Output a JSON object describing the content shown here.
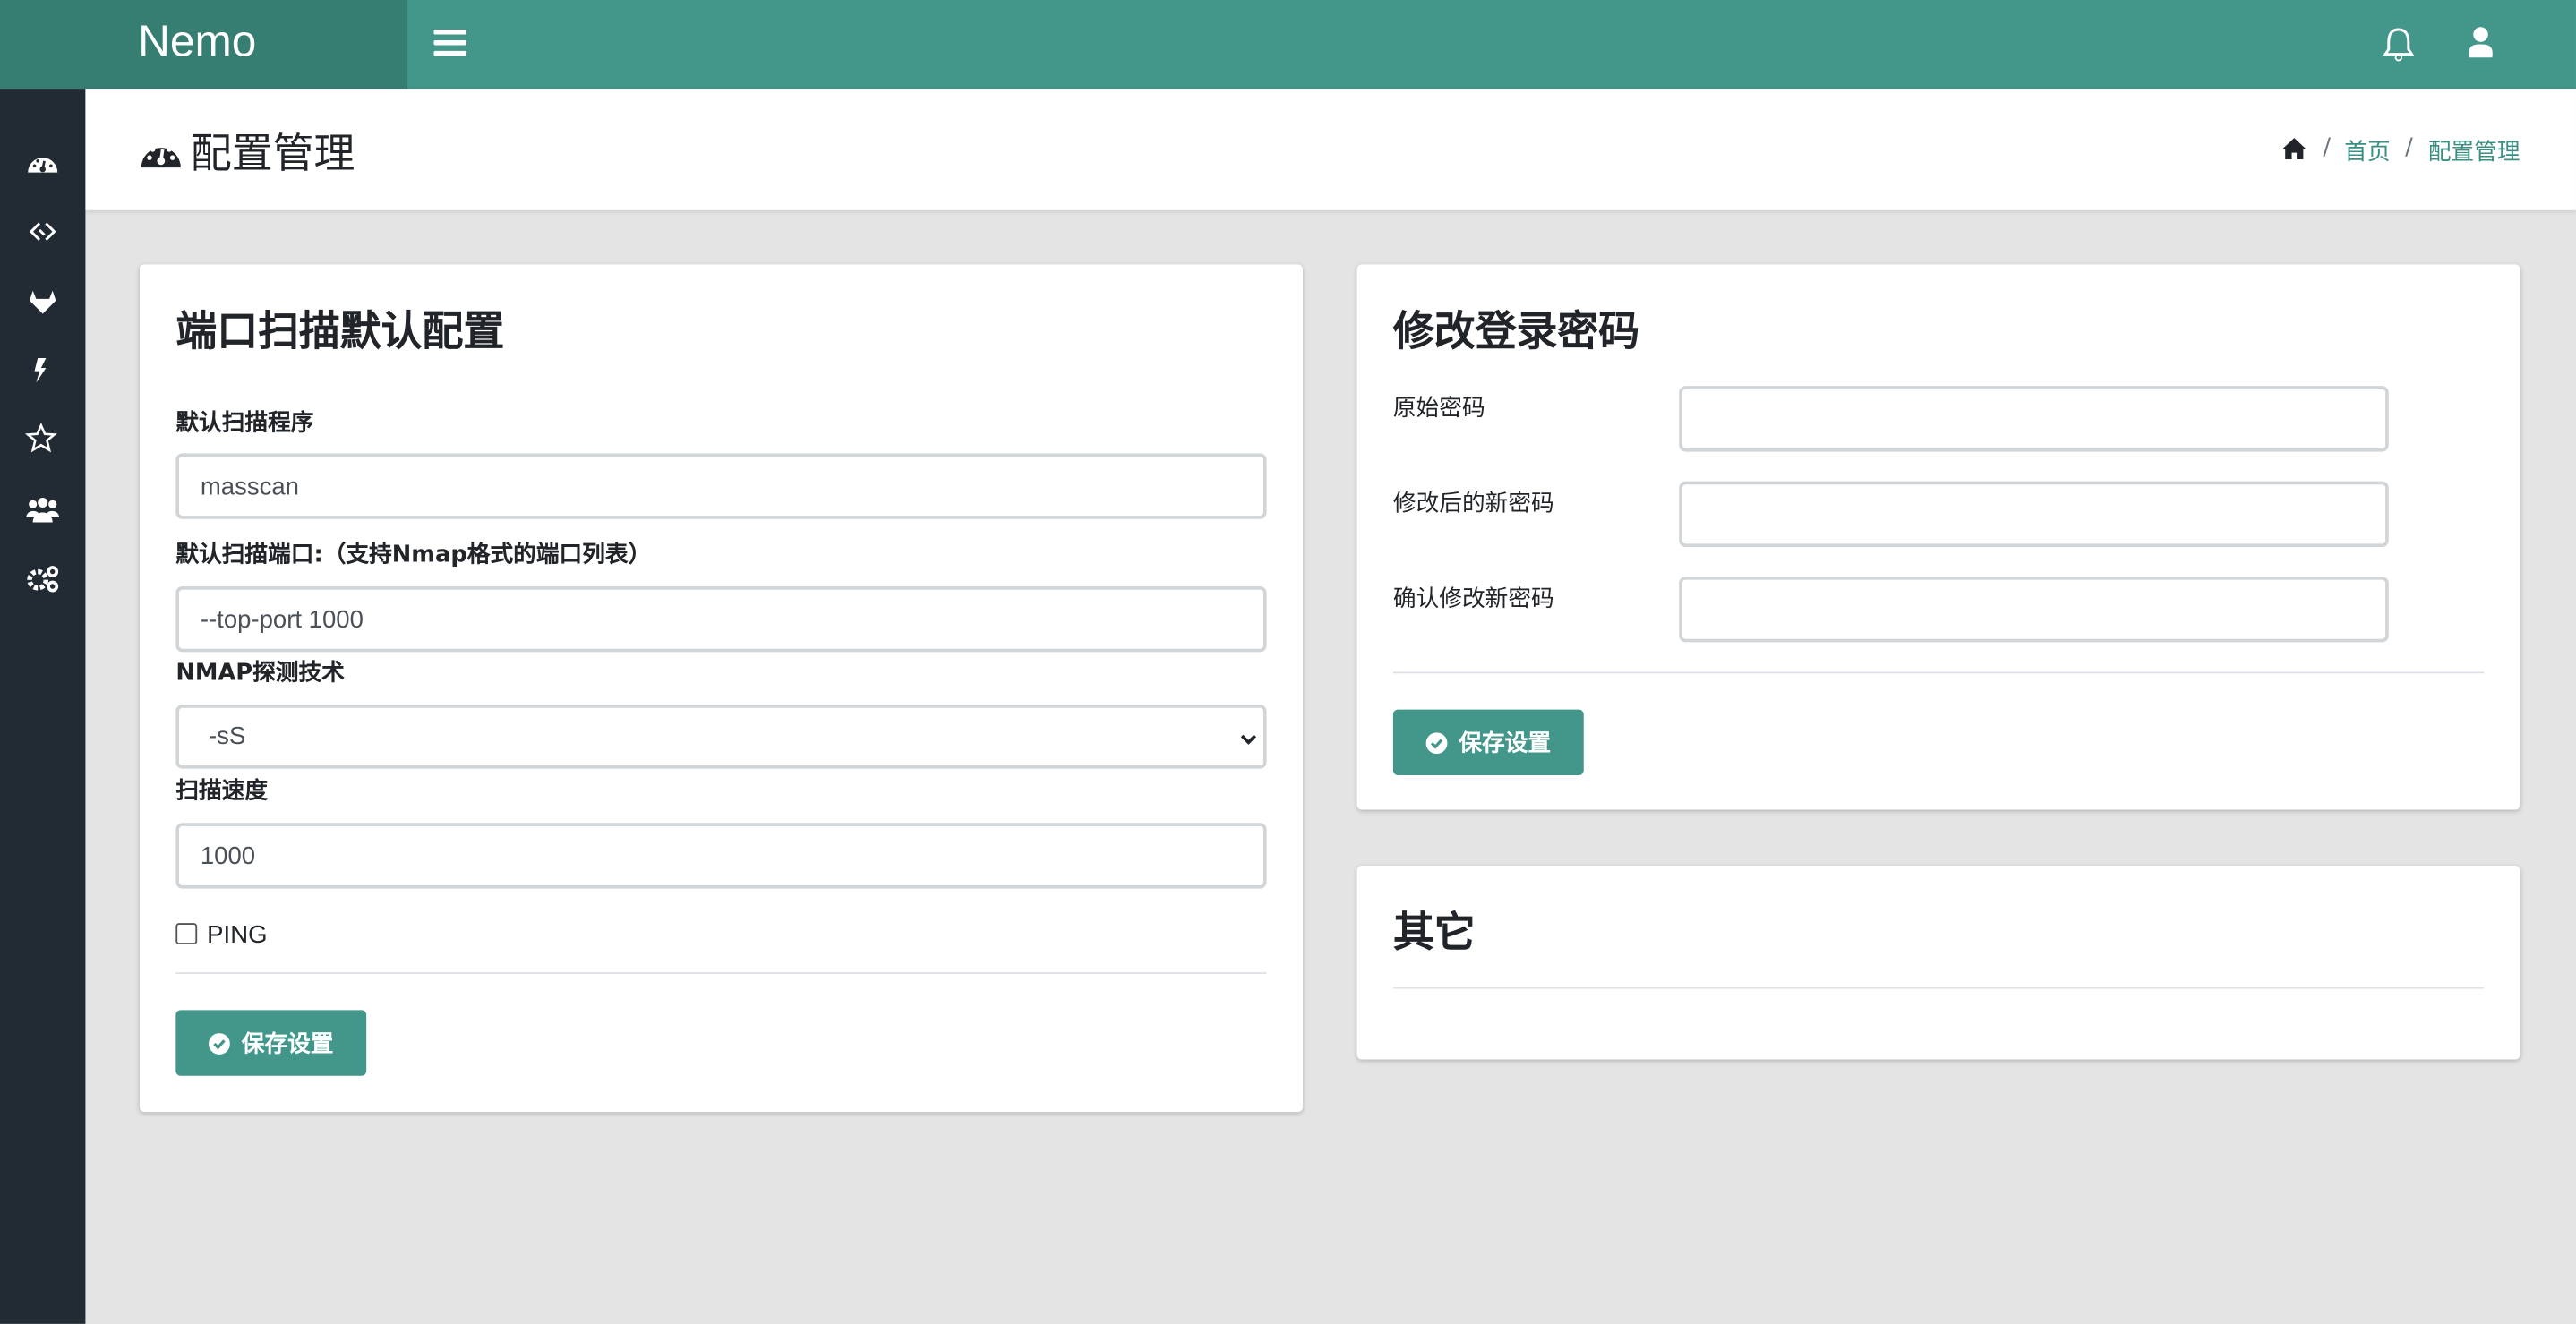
{
  "app": {
    "brand": "Nemo"
  },
  "header": {
    "title": "配置管理",
    "breadcrumb": [
      "首页",
      "配置管理"
    ],
    "separator": "/"
  },
  "sidebar": {
    "icons": [
      "dashboard-icon",
      "link-icon",
      "gitlab-icon",
      "bolt-icon",
      "star-icon",
      "users-icon",
      "cogs-icon"
    ]
  },
  "colors": {
    "primary": "#42968a",
    "brand_bg": "#367d72",
    "sidebar_bg": "#222b33",
    "page_bg": "#e4e4e4"
  },
  "port_scan": {
    "title": "端口扫描默认配置",
    "program_label": "默认扫描程序",
    "program_value": "masscan",
    "ports_label": "默认扫描端口:（支持Nmap格式的端口列表）",
    "ports_value": "--top-port 1000",
    "tech_label": "NMAP探测技术",
    "tech_value": "-sS",
    "rate_label": "扫描速度",
    "rate_value": "1000",
    "ping_label": "PING",
    "ping_checked": false,
    "save_label": "保存设置"
  },
  "password": {
    "title": "修改登录密码",
    "old_label": "原始密码",
    "new_label": "修改后的新密码",
    "confirm_label": "确认修改新密码",
    "save_label": "保存设置"
  },
  "other": {
    "title": "其它"
  }
}
